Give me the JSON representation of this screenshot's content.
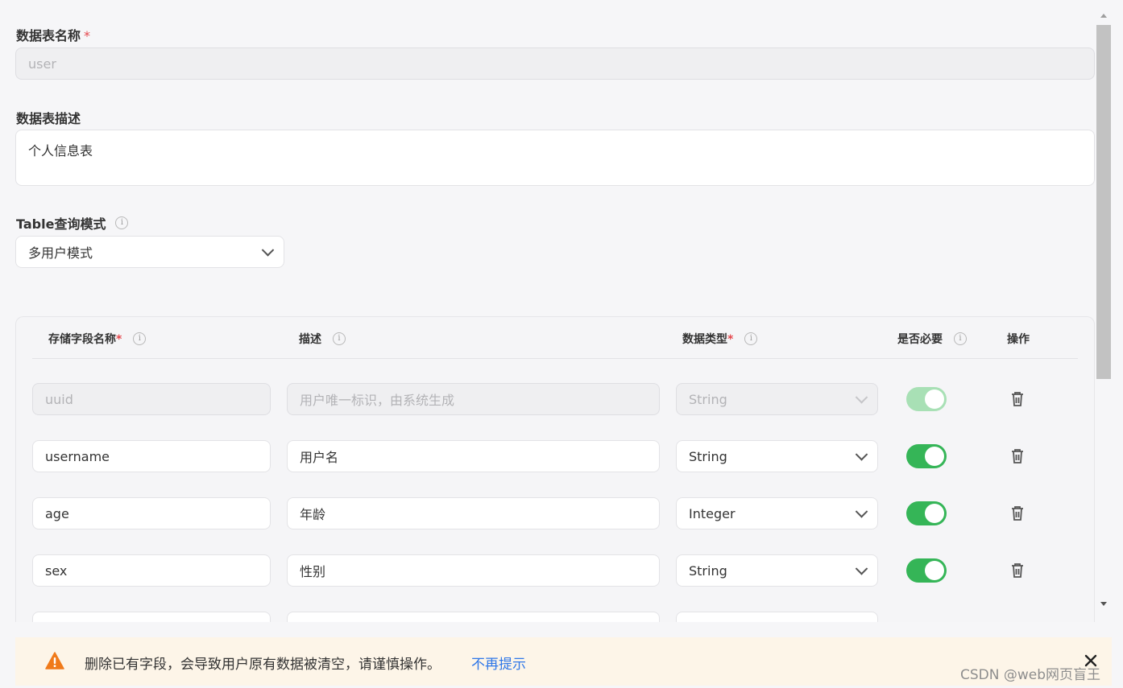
{
  "form": {
    "table_name": {
      "label": "数据表名称",
      "required_mark": "*",
      "value": "user"
    },
    "table_desc": {
      "label": "数据表描述",
      "value": "个人信息表"
    },
    "query_mode": {
      "label": "Table查询模式",
      "value": "多用户模式"
    }
  },
  "fields_table": {
    "headers": {
      "name": "存储字段名称",
      "name_required": "*",
      "desc": "描述",
      "type": "数据类型",
      "type_required": "*",
      "required": "是否必要",
      "actions": "操作"
    },
    "rows": [
      {
        "name": "",
        "name_placeholder": "uuid",
        "desc": "",
        "desc_placeholder": "用户唯一标识，由系统生成",
        "type": "String",
        "required_on": true,
        "disabled": true
      },
      {
        "name": "username",
        "desc": "用户名",
        "type": "String",
        "required_on": true,
        "disabled": false
      },
      {
        "name": "age",
        "desc": "年龄",
        "type": "Integer",
        "required_on": true,
        "disabled": false
      },
      {
        "name": "sex",
        "desc": "性别",
        "type": "String",
        "required_on": true,
        "disabled": false
      }
    ]
  },
  "notice": {
    "text": "删除已有字段，会导致用户原有数据被清空，请谨慎操作。",
    "link": "不再提示"
  },
  "watermark": "CSDN @web网页盲王",
  "colors": {
    "switch_on": "#35b557",
    "link": "#2f77e8",
    "warning": "#f07a1a",
    "required": "#e5484d"
  },
  "icons": [
    "info-icon",
    "chevron-down-icon",
    "trash-icon",
    "warning-icon",
    "close-icon"
  ]
}
